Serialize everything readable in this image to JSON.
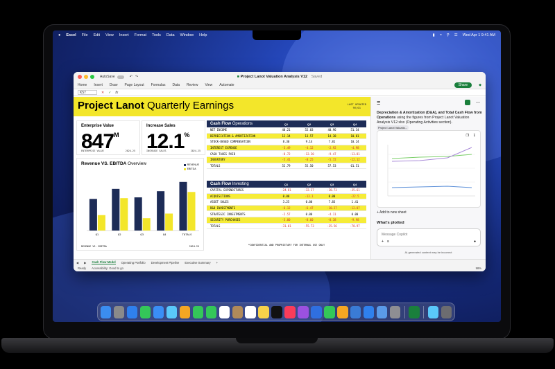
{
  "menubar": {
    "app": "Excel",
    "items": [
      "File",
      "Edit",
      "View",
      "Insert",
      "Format",
      "Tools",
      "Data",
      "Window",
      "Help"
    ],
    "datetime": "Wed Apr 1 9:41 AM"
  },
  "window": {
    "autosave": "AutoSave",
    "title": "Project Lanot Valuation Analysis V12",
    "saved": "Saved",
    "share": "Share",
    "ribbon_tabs": [
      "Home",
      "Insert",
      "Draw",
      "Page Layout",
      "Formulas",
      "Data",
      "Review",
      "View",
      "Automate"
    ],
    "namebox": "K57",
    "fx": "fx"
  },
  "banner": {
    "title_bold": "Project Lanot",
    "title_light": "Quarterly Earnings",
    "last_updated_label": "LAST UPDATED",
    "last_updated_value": "9V/01"
  },
  "kpis": [
    {
      "label": "Enterprise Value",
      "value": "847",
      "suffix": "M",
      "foot_left": "ENTERPRISE VALUE",
      "foot_right": "2024-25"
    },
    {
      "label": "Increase Sales",
      "value": "12.1",
      "suffix": "%",
      "foot_left": "INCREASE SALES",
      "foot_right": "2024-25"
    }
  ],
  "revchart": {
    "title_bold": "Revenue VS. EBITDA",
    "title_light": "Overview",
    "legend": [
      "REVENUE",
      "EBITDA"
    ],
    "foot_left": "REVENUE VS. EBITDA",
    "foot_right": "2024-25"
  },
  "chart_data": {
    "type": "bar",
    "title": "Revenue VS. EBITDA Overview",
    "categories": [
      "Q1",
      "Q2",
      "Q3",
      "Q4",
      "TOTALS"
    ],
    "series": [
      {
        "name": "REVENUE",
        "values": [
          41,
          54,
          43,
          51,
          63
        ]
      },
      {
        "name": "EBITDA",
        "values": [
          20,
          42,
          16,
          22,
          50
        ]
      }
    ],
    "ylim": [
      0,
      70
    ],
    "colors": {
      "REVENUE": "#1d2c57",
      "EBITDA": "#f3e62a"
    }
  },
  "quarters": [
    "Q1",
    "Q2",
    "Q3",
    "Q4"
  ],
  "operations": {
    "title_bold": "Cash Flow",
    "title_light": "Operations",
    "rows": [
      {
        "name": "NET INCOME",
        "vals": [
          "40.21",
          "52.03",
          "40.96",
          "51.34"
        ],
        "hl": false
      },
      {
        "name": "DEPRECIATION & AMORTIZATION",
        "vals": [
          "12.14",
          "13.57",
          "14.38",
          "10.81"
        ],
        "hl": true
      },
      {
        "name": "STOCK-BASED COMPENSATION",
        "vals": [
          "8.30",
          "9.14",
          "7.81",
          "10.24"
        ],
        "hl": false
      },
      {
        "name": "INTEREST EXPENSE",
        "vals": [
          "-3.49",
          "-4.12",
          "-2.92",
          "-4.98"
        ],
        "hl": true
      },
      {
        "name": "CASH TAXES PAID",
        "vals": [
          "-8.72",
          "-12.20",
          "-9.47",
          "-13.81"
        ],
        "hl": false
      },
      {
        "name": "INVENTORY",
        "vals": [
          "-5.41",
          "-8.25",
          "-5.72",
          "-12.12"
        ],
        "hl": true
      },
      {
        "name": "TOTALS",
        "vals": [
          "52.79",
          "55.50",
          "57.53",
          "61.51"
        ],
        "hl": false
      }
    ]
  },
  "investing": {
    "title_bold": "Cash Flow",
    "title_light": "Investing",
    "rows": [
      {
        "name": "CAPITAL EXPENDITURES",
        "vals": [
          "-24.81",
          "-32.27",
          "-20.73",
          "-35.61"
        ],
        "hl": false
      },
      {
        "name": "ACQUISITIONS",
        "vals": [
          "0.00",
          "-13.1",
          "0.00",
          "-22.5"
        ],
        "hl": true
      },
      {
        "name": "ASSET SALES",
        "vals": [
          "3.25",
          "0.00",
          "7.83",
          "1.41"
        ],
        "hl": false
      },
      {
        "name": "R&D INVESTMENTS",
        "vals": [
          "-6.12",
          "-6.47",
          "-10.27",
          "-12.07"
        ],
        "hl": true
      },
      {
        "name": "STRATEGIC INVESTMENTS",
        "vals": [
          "-2.57",
          "0.00",
          "-4.11",
          "0.00"
        ],
        "hl": false
      },
      {
        "name": "SECURITY PURCHASES",
        "vals": [
          "-3.00",
          "-8.60",
          "-8.38",
          "-9.98"
        ],
        "hl": true
      },
      {
        "name": "TOTALS",
        "vals": [
          "-31.01",
          "-55.73",
          "-35.56",
          "-78.97"
        ],
        "hl": false
      }
    ]
  },
  "confidential": "*CONFIDENTIAL AND PROPRIETARY FOR INTERNAL USE ONLY",
  "sheet_tabs": [
    "Cash Flow Model",
    "Operating Portfolio",
    "Development Pipeline",
    "Executive Summary"
  ],
  "status": {
    "ready": "Ready",
    "accessibility": "Accessibility: Good to go",
    "zoom": "98%"
  },
  "copilot": {
    "message_bold": "Depreciation & Amortization (D&A), and Total Cash Flow from Operations",
    "message_rest": " using the figures from Project Lanot Valuation Analysis V12.xlsx (Operating Activities section).",
    "chip": "Project Lanot Valuatio...",
    "add_sheet": "Add to new sheet",
    "whats_plotted": "What's plotted",
    "placeholder": "Message Copilot",
    "disclaimer": "AI-generated content may be incorrect"
  },
  "dock_icons": [
    "finder-icon",
    "launchpad-icon",
    "safari-icon",
    "messages-icon",
    "mail-icon",
    "maps-icon",
    "photos-icon",
    "facetime-icon",
    "phone-icon",
    "calendar-icon",
    "contacts-icon",
    "reminders-icon",
    "notes-icon",
    "tv-icon",
    "music-icon",
    "podcasts-icon",
    "keynote-icon",
    "numbers-icon",
    "pages-icon",
    "xcode-icon",
    "app-store-icon",
    "preview-icon",
    "settings-icon",
    "excel-icon",
    "folder-icon",
    "trash-icon"
  ]
}
